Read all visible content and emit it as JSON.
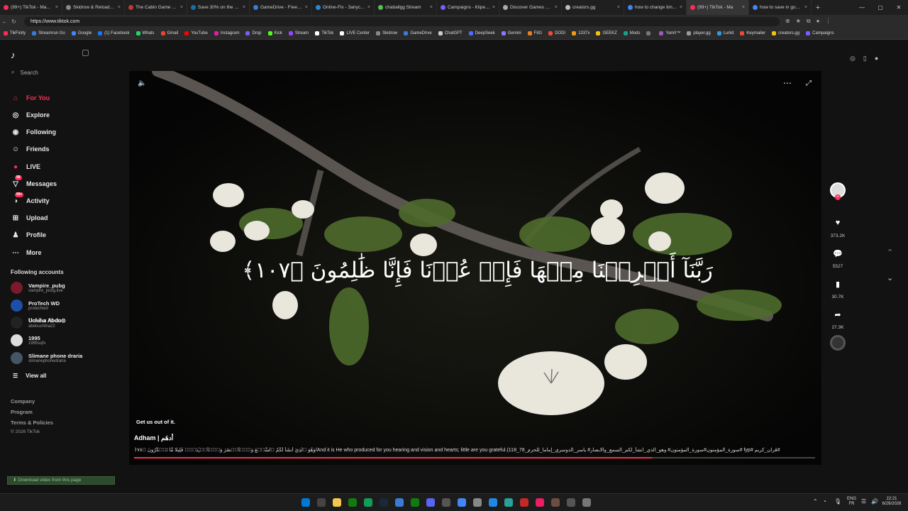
{
  "browser": {
    "tabs": [
      {
        "title": "(99+) TikTok - Make Yo",
        "color": "#fe2c55"
      },
      {
        "title": "Skidrow & Reloaded G",
        "color": "#888888"
      },
      {
        "title": "The Cabin Game Early",
        "color": "#c0392b"
      },
      {
        "title": "Save 30% on the cab",
        "color": "#1b6fa8"
      },
      {
        "title": "GameDrive - Free Do",
        "color": "#3a7bd5"
      },
      {
        "title": "Online-Fix - Запуск и",
        "color": "#2d88d1"
      },
      {
        "title": "chaballgg Stream",
        "color": "#53c24a"
      },
      {
        "title": "Campaigns - Klipeak",
        "color": "#7a5cff"
      },
      {
        "title": "Discover Games with",
        "color": "#aaaaaa"
      },
      {
        "title": "creators.gg",
        "color": "#bbbbbb"
      },
      {
        "title": "how to change time f",
        "color": "#4285f4"
      },
      {
        "title": "(99+) TikTok - Ma",
        "color": "#fe2c55"
      },
      {
        "title": "how to save in god of",
        "color": "#4285f4"
      }
    ],
    "active_tab_index": 11,
    "new_tab": "+",
    "url": "https://www.tiktok.com",
    "bookmarks": [
      {
        "label": "TikFinity",
        "color": "#fe2c55"
      },
      {
        "label": "Streamrun Go",
        "color": "#3a7bd5"
      },
      {
        "label": "Google",
        "color": "#4285f4"
      },
      {
        "label": "(1) Facebook",
        "color": "#1877f2"
      },
      {
        "label": "Whats",
        "color": "#25d366"
      },
      {
        "label": "Gmail",
        "color": "#ea4335"
      },
      {
        "label": "YouTube",
        "color": "#ff0000"
      },
      {
        "label": "Instagram",
        "color": "#d6249f"
      },
      {
        "label": "Drop",
        "color": "#7f5af0"
      },
      {
        "label": "Kick",
        "color": "#53fc18"
      },
      {
        "label": "Stream",
        "color": "#9146ff"
      },
      {
        "label": "TikTok",
        "color": "#ffffff"
      },
      {
        "label": "LIVE Center",
        "color": "#ffffff"
      },
      {
        "label": "Skidrow",
        "color": "#888888"
      },
      {
        "label": "GameDrive",
        "color": "#3a7bd5"
      },
      {
        "label": "ChatGPT",
        "color": "#cccccc"
      },
      {
        "label": "DeepSeek",
        "color": "#4d6bfe"
      },
      {
        "label": "Gemini",
        "color": "#8e75ff"
      },
      {
        "label": "FitG",
        "color": "#e67e22"
      },
      {
        "label": "DODI",
        "color": "#e74c3c"
      },
      {
        "label": "1337x",
        "color": "#f39c12"
      },
      {
        "label": "GEEKZ",
        "color": "#f1c40f"
      },
      {
        "label": "Mods",
        "color": "#16a085"
      },
      {
        "label": "",
        "color": "#777777"
      },
      {
        "label": "Yami!™",
        "color": "#9b59b6"
      },
      {
        "label": "player.gg",
        "color": "#999999"
      },
      {
        "label": "Lurkit",
        "color": "#3498db"
      },
      {
        "label": "Keymailer",
        "color": "#e74c3c"
      },
      {
        "label": "creators.gg",
        "color": "#f1c40f"
      },
      {
        "label": "Campaigns",
        "color": "#7a5cff"
      }
    ]
  },
  "sidebar": {
    "search_placeholder": "Search",
    "nav": [
      {
        "label": "For You",
        "icon": "home-icon",
        "active": true
      },
      {
        "label": "Explore",
        "icon": "compass-icon"
      },
      {
        "label": "Following",
        "icon": "following-icon"
      },
      {
        "label": "Friends",
        "icon": "friends-icon"
      },
      {
        "label": "LIVE",
        "icon": "live-icon"
      },
      {
        "label": "Messages",
        "icon": "messages-icon",
        "badge": "98"
      },
      {
        "label": "Activity",
        "icon": "activity-icon",
        "badge": "99+"
      },
      {
        "label": "Upload",
        "icon": "upload-icon"
      },
      {
        "label": "Profile",
        "icon": "profile-icon"
      },
      {
        "label": "More",
        "icon": "more-icon"
      }
    ],
    "following_heading": "Following accounts",
    "accounts": [
      {
        "name": "Vampire_pubg",
        "handle": "vampire_pubg.live",
        "color": "#7a1a2a"
      },
      {
        "name": "ProTech WD",
        "handle": "protechwd",
        "color": "#1d4fa8"
      },
      {
        "name": "𝐔𝐜𝐡𝐢𝐡𝐚 𝐀𝐛𝐝𝐨⚙",
        "handle": "abdouchiha22",
        "color": "#222222"
      },
      {
        "name": "1995",
        "handle": "1995sqfx",
        "color": "#dddddd"
      },
      {
        "name": "Slimane phone draria",
        "handle": "slimanephonedraria",
        "color": "#445566"
      }
    ],
    "view_all": "View all",
    "footer": [
      "Company",
      "Program",
      "Terms & Policies"
    ],
    "copyright": "© 2026 TikTok",
    "download_button": "Download video from this page"
  },
  "video": {
    "overlay_text": "رَبَّنَآ أَخۡرِجۡنَا مِنۡهَا فَإِنۡ عُدۡنَا فَإِنَّا ظَٰلِمُونَ ﴿١٠٧﴾",
    "subtitle": "Get us out of it.",
    "author": "Adham | أدهَم",
    "description": "﴿وَهُوَ ٱلَّذِيٓ أَنشَأَ لَكُمُ ٱلسَّمۡعَ وَٱلۡأَبۡصَٰرَ وَٱلۡأَفۡـِٔدَةَۚ قَلِيلٗا مَّا تَشۡكُرُونَ ﴿٧٨/And it is He who produced for you hearing and vision and hearts; little are you grateful.(118_78_سورة_المؤمنون#سورة_المؤمنون# وهو_الذي_انشأ_لكم_السمع_والابصار# ياسر_الدوسري_إماما_للحرم# fyp# قران_كريم#",
    "progress": 0.76
  },
  "actions": {
    "likes": "373.2K",
    "comments": "5527",
    "saves": "30.7K",
    "shares": "27.3K"
  },
  "system": {
    "lang_top": "ENG",
    "lang_bottom": "FR",
    "time": "22:21",
    "date": "6/29/2026"
  }
}
